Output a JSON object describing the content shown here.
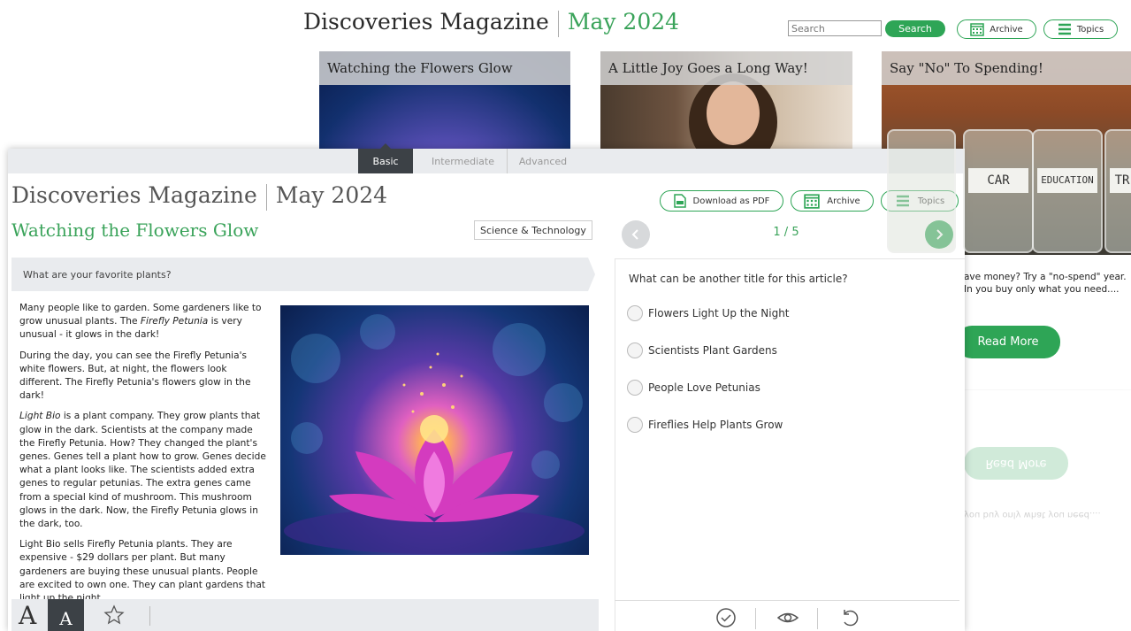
{
  "background": {
    "brand": "Discoveries Magazine",
    "issue": "May 2024",
    "search": {
      "placeholder": "Search",
      "button": "Search"
    },
    "archive_label": "Archive",
    "topics_label": "Topics",
    "cards": [
      {
        "title": "Watching the Flowers Glow"
      },
      {
        "title": "A Little Joy Goes a Long Way!"
      },
      {
        "title": "Say \"No\" To Spending!"
      }
    ],
    "jar_labels": [
      "CAR",
      "EDUCATION",
      "TR"
    ],
    "summary": "ave money? Try a \"no-spend\" year. In you buy only what you need....",
    "read_more": "Read More",
    "reflect_read_more": "Read More",
    "reflect_text": "you buy only what you need...."
  },
  "panel": {
    "levels": [
      "Basic",
      "Intermediate",
      "Advanced"
    ],
    "active_level": "Basic",
    "brand": "Discoveries Magazine",
    "issue": "May 2024",
    "article_title": "Watching the Flowers Glow",
    "category": "Science & Technology",
    "prompt": "What are your favorite plants?",
    "actions": {
      "pdf": "Download as PDF",
      "archive": "Archive",
      "topics": "Topics"
    },
    "article": {
      "p1_a": "Many people like to garden. Some gardeners like to grow unusual plants. The ",
      "p1_em": "Firefly Petunia",
      "p1_b": " is very unusual - it glows in the dark!",
      "p2": "During the day, you can see the Firefly Petunia's white flowers. But, at night, the flowers look different. The Firefly Petunia's flowers glow in the dark!",
      "p3_em": "Light Bio",
      "p3_b": " is a plant company. They grow plants that glow in the dark. Scientists at the company made the Firefly Petunia. How? They changed the plant's genes. Genes tell a plant how to grow. Genes decide what a plant looks like. The scientists added extra genes to regular petunias. The extra genes came from a special kind of mushroom. This mushroom glows in the dark. Now, the Firefly Petunia glows in the dark, too.",
      "p4": "Light Bio sells Firefly Petunia plants. They are expensive - $29 dollars per plant. But many gardeners are buying these unusual plants. People are excited to own one. They can plant gardens that light up the night."
    },
    "font_large": "A",
    "font_small": "A",
    "quiz": {
      "counter": "1 / 5",
      "question": "What can be another title for this article?",
      "options": [
        "Flowers Light Up the Night",
        "Scientists Plant Gardens",
        "People Love Petunias",
        "Fireflies Help Plants Grow"
      ]
    }
  },
  "colors": {
    "accent": "#2ea556",
    "title_green": "#3aa35a",
    "dark_tab": "#3c4146",
    "bar_gray": "#e9ebee"
  },
  "icons": [
    "calendar-icon",
    "menu-icon",
    "pdf-icon",
    "star-icon",
    "check-circle-icon",
    "eye-icon",
    "undo-icon",
    "chevron-left-icon",
    "chevron-right-icon"
  ]
}
